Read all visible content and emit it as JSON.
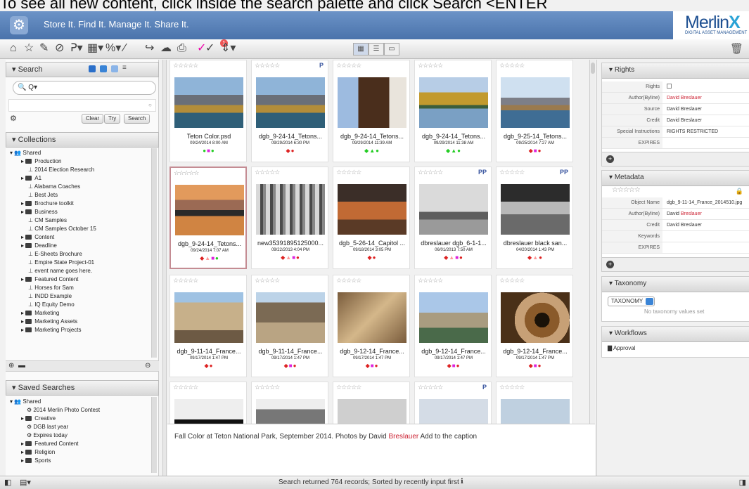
{
  "top_cutoff_text": "To see all new content, click inside the search palette and click Search <ENTER",
  "app": {
    "tagline": "Store It. Find It. Manage It. Share It.",
    "logo_text": "Merlin",
    "logo_suffix": "X",
    "logo_sub": "DIGITAL ASSET MANAGEMENT",
    "notification_count": "1"
  },
  "search": {
    "header": "Search",
    "placeholder": "Q",
    "clear_label": "Clear",
    "try_label": "Try",
    "search_label": "Search"
  },
  "collections": {
    "header": "Collections",
    "items": [
      {
        "label": "Shared",
        "type": "group"
      },
      {
        "label": "Production",
        "type": "folder"
      },
      {
        "label": "2014 Election Research",
        "type": "pin"
      },
      {
        "label": "A1",
        "type": "folder"
      },
      {
        "label": "Alabama Coaches",
        "type": "pin"
      },
      {
        "label": "Best Jets",
        "type": "pin"
      },
      {
        "label": "Brochure toolkit",
        "type": "folder"
      },
      {
        "label": "Business",
        "type": "folder"
      },
      {
        "label": "CM Samples",
        "type": "pin"
      },
      {
        "label": "CM Samples October 15",
        "type": "pin"
      },
      {
        "label": "Content",
        "type": "folder"
      },
      {
        "label": "Deadline",
        "type": "folder"
      },
      {
        "label": "E-Sheets Brochure",
        "type": "pin"
      },
      {
        "label": "Empire State Project-01",
        "type": "pin"
      },
      {
        "label": "event name goes here.",
        "type": "pin"
      },
      {
        "label": "Featured Content",
        "type": "folder"
      },
      {
        "label": "Horses for Sam",
        "type": "pin"
      },
      {
        "label": "INDD Example",
        "type": "pin"
      },
      {
        "label": "IQ Equity Demo",
        "type": "pin"
      },
      {
        "label": "Marketing",
        "type": "folder"
      },
      {
        "label": "Marketing Assets",
        "type": "folder"
      },
      {
        "label": "Marketing Projects",
        "type": "folder"
      }
    ]
  },
  "saved_searches": {
    "header": "Saved Searches",
    "items": [
      {
        "label": "Shared",
        "type": "group"
      },
      {
        "label": "2014 Merlin Photo Contest",
        "type": "search"
      },
      {
        "label": "Creative",
        "type": "folder"
      },
      {
        "label": "DGB last year",
        "type": "search"
      },
      {
        "label": "Expires today",
        "type": "search"
      },
      {
        "label": "Featured Content",
        "type": "folder"
      },
      {
        "label": "Religion",
        "type": "folder"
      },
      {
        "label": "Sports",
        "type": "folder"
      }
    ]
  },
  "assets": [
    {
      "name": "Teton Color.psd",
      "date": "09/24/2014 8:00 AM",
      "stars": "☆☆☆☆☆",
      "flag": "",
      "thumb": "mountain-lake",
      "dots": [
        [
          "●",
          "#2c2"
        ],
        [
          "■",
          "#d2d"
        ],
        [
          "●",
          "#2c2"
        ]
      ]
    },
    {
      "name": "dgb_9-24-14_Tetons...",
      "date": "09/29/2014 6:30 PM",
      "stars": "☆☆☆☆☆",
      "flag": "P",
      "thumb": "mountain-lake",
      "dots": [
        [
          "◆",
          "#d22"
        ],
        [
          "●",
          "#d22"
        ]
      ]
    },
    {
      "name": "dgb_9-24-14_Tetons...",
      "date": "09/29/2014 11:39 AM",
      "stars": "☆☆☆☆☆",
      "flag": "",
      "thumb": "horse",
      "dots": [
        [
          "◆",
          "#2c2"
        ],
        [
          "▲",
          "#2c2"
        ],
        [
          "●",
          "#2c2"
        ]
      ]
    },
    {
      "name": "dgb_9-24-14_Tetons...",
      "date": "09/29/2014 11:38 AM",
      "stars": "☆☆☆☆☆",
      "flag": "",
      "thumb": "autumn-lake",
      "dots": [
        [
          "◆",
          "#2c2"
        ],
        [
          "▲",
          "#2c2"
        ],
        [
          "●",
          "#2c2"
        ]
      ]
    },
    {
      "name": "dgb_9-25-14_Tetons...",
      "date": "09/25/2014 7:27 AM",
      "stars": "☆☆☆☆☆",
      "flag": "",
      "thumb": "mountain-blue",
      "dots": [
        [
          "◆",
          "#d22"
        ],
        [
          "■",
          "#d2d"
        ],
        [
          "●",
          "#d22"
        ]
      ]
    },
    {
      "name": "dgb_9-24-14_Tetons...",
      "date": "09/24/2014 7:07 AM",
      "stars": "☆☆☆☆☆",
      "flag": "",
      "thumb": "sunset-lake",
      "dots": [
        [
          "◆",
          "#d22"
        ],
        [
          "▲",
          "#f99"
        ],
        [
          "■",
          "#d2d"
        ],
        [
          "●",
          "#2c2"
        ]
      ]
    },
    {
      "name": "new35391895125000...",
      "date": "09/22/2013 4:04 PM",
      "stars": "☆☆☆☆☆",
      "flag": "",
      "thumb": "aspen",
      "dots": [
        [
          "◆",
          "#d22"
        ],
        [
          "▲",
          "#f99"
        ],
        [
          "■",
          "#d2d"
        ],
        [
          "●",
          "#d22"
        ]
      ]
    },
    {
      "name": "dgb_5-26-14_Capitol ...",
      "date": "09/18/2014 3:05 PM",
      "stars": "☆☆☆☆☆",
      "flag": "",
      "thumb": "rock",
      "dots": [
        [
          "◆",
          "#d22"
        ],
        [
          "●",
          "#d22"
        ]
      ]
    },
    {
      "name": "dbreslauer dgb_6-1-1...",
      "date": "06/01/2013 7:50 AM",
      "stars": "☆☆☆☆☆",
      "flag": "PP",
      "thumb": "field",
      "dots": [
        [
          "◆",
          "#d22"
        ],
        [
          "▲",
          "#f99"
        ],
        [
          "■",
          "#d2d"
        ],
        [
          "●",
          "#d22"
        ]
      ]
    },
    {
      "name": "dbreslauer black san...",
      "date": "04/20/2014 1:43 PM",
      "stars": "☆☆☆☆☆",
      "flag": "PP",
      "thumb": "beach",
      "dots": [
        [
          "◆",
          "#d22"
        ],
        [
          "▲",
          "#f99"
        ],
        [
          "●",
          "#d22"
        ]
      ]
    },
    {
      "name": "dgb_9-11-14_France...",
      "date": "09/17/2014 1:47 PM",
      "stars": "☆☆☆☆☆",
      "flag": "",
      "thumb": "castle",
      "dots": [
        [
          "◆",
          "#d22"
        ],
        [
          "●",
          "#d22"
        ]
      ]
    },
    {
      "name": "dgb_9-11-14_France...",
      "date": "09/17/2014 1:47 PM",
      "stars": "☆☆☆☆☆",
      "flag": "",
      "thumb": "arch",
      "dots": [
        [
          "◆",
          "#d22"
        ],
        [
          "■",
          "#d2d"
        ],
        [
          "●",
          "#d22"
        ]
      ]
    },
    {
      "name": "dgb_9-12-14_France...",
      "date": "09/17/2014 1:47 PM",
      "stars": "☆☆☆☆☆",
      "flag": "",
      "thumb": "vault",
      "dots": [
        [
          "◆",
          "#d22"
        ],
        [
          "■",
          "#d2d"
        ],
        [
          "●",
          "#d22"
        ]
      ]
    },
    {
      "name": "dgb_9-12-14_France...",
      "date": "09/17/2014 1:47 PM",
      "stars": "☆☆☆☆☆",
      "flag": "",
      "thumb": "chateau",
      "dots": [
        [
          "◆",
          "#d22"
        ],
        [
          "■",
          "#d2d"
        ],
        [
          "●",
          "#d22"
        ]
      ]
    },
    {
      "name": "dgb_9-12-14_France...",
      "date": "09/17/2014 1:47 PM",
      "stars": "☆☆☆☆☆",
      "flag": "",
      "thumb": "spiral",
      "dots": [
        [
          "◆",
          "#d22"
        ],
        [
          "■",
          "#d2d"
        ],
        [
          "●",
          "#d22"
        ]
      ]
    },
    {
      "name": "",
      "date": "",
      "stars": "☆☆☆☆☆",
      "flag": "",
      "thumb": "dark",
      "dots": []
    },
    {
      "name": "",
      "date": "",
      "stars": "☆☆☆☆☆",
      "flag": "",
      "thumb": "bw-rock",
      "dots": []
    },
    {
      "name": "",
      "date": "",
      "stars": "☆☆☆☆☆",
      "flag": "",
      "thumb": "sky",
      "dots": []
    },
    {
      "name": "",
      "date": "",
      "stars": "☆☆☆☆☆",
      "flag": "P",
      "thumb": "plane",
      "dots": []
    },
    {
      "name": "",
      "date": "",
      "stars": "☆☆☆☆☆",
      "flag": "",
      "thumb": "tower",
      "dots": []
    }
  ],
  "caption": {
    "text_before": "Fall Color at Teton National Park, September 2014. Photos by David ",
    "highlight": "Breslauer",
    "text_after": " Add to the caption"
  },
  "rights": {
    "header": "Rights",
    "rows": [
      {
        "k": "Rights",
        "v": "",
        "checkbox": true
      },
      {
        "k": "Author(Byline)",
        "v": "David Breslauer",
        "red": true
      },
      {
        "k": "Source",
        "v": "David Breslauer"
      },
      {
        "k": "Credit",
        "v": "David Breslauer"
      },
      {
        "k": "Special Instructions",
        "v": "RIGHTS RESTRICTED"
      },
      {
        "k": "EXPIRES",
        "v": ""
      }
    ]
  },
  "metadata": {
    "header": "Metadata",
    "stars": "☆☆☆☆☆",
    "rows": [
      {
        "k": "Object Name",
        "v": "dgb_9-11-14_France_2014510.jpg"
      },
      {
        "k": "Author(Byline)",
        "v_prefix": "David ",
        "v": "Breslauer",
        "red": true
      },
      {
        "k": "Credit",
        "v": "David Breslauer"
      },
      {
        "k": "Keywords",
        "v": ""
      },
      {
        "k": "EXPIRES",
        "v": ""
      }
    ]
  },
  "taxonomy": {
    "header": "Taxonomy",
    "select": "TAXONOMY",
    "empty": "No taxonomy values set"
  },
  "workflows": {
    "header": "Workflows",
    "item": "Approval"
  },
  "status": {
    "text": "Search returned 764 records; Sorted by recently input first"
  }
}
